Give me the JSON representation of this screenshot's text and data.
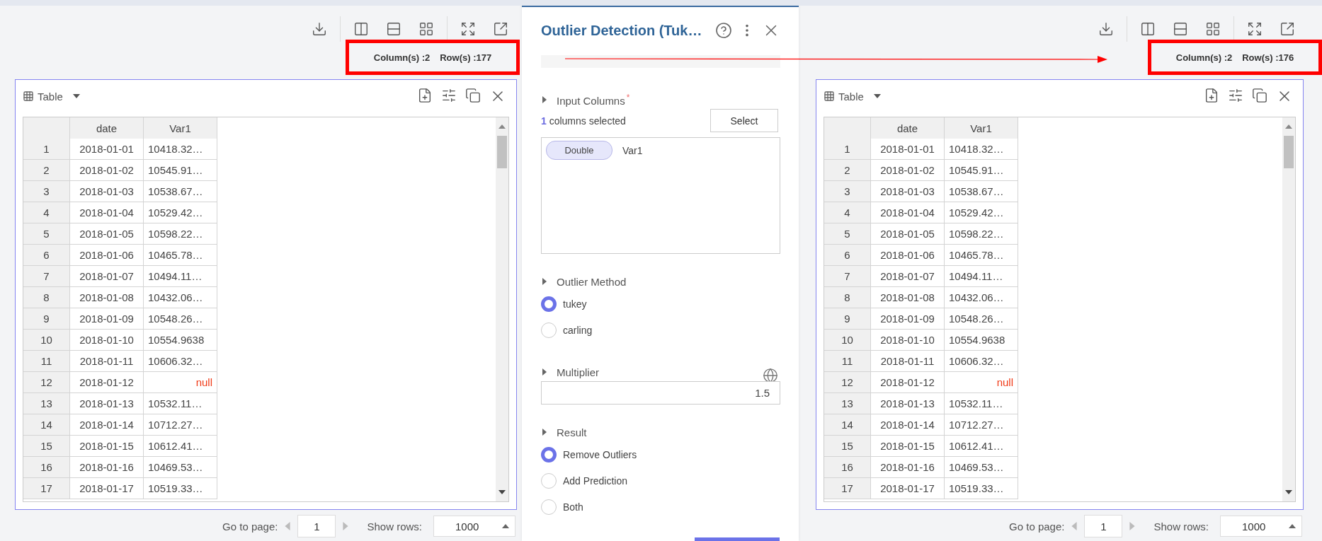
{
  "panes": [
    {
      "counts": {
        "columns": "Column(s) :2",
        "rows": "Row(s) :177",
        "highlighted": true
      },
      "table": {
        "title": "Table",
        "columns": [
          "date",
          "Var1"
        ],
        "rows": [
          {
            "index": "1",
            "date": "2018-01-01",
            "var1": "10418.32…",
            "kind": "number"
          },
          {
            "index": "2",
            "date": "2018-01-02",
            "var1": "10545.91…",
            "kind": "number"
          },
          {
            "index": "3",
            "date": "2018-01-03",
            "var1": "10538.67…",
            "kind": "number"
          },
          {
            "index": "4",
            "date": "2018-01-04",
            "var1": "10529.42…",
            "kind": "number"
          },
          {
            "index": "5",
            "date": "2018-01-05",
            "var1": "10598.22…",
            "kind": "number"
          },
          {
            "index": "6",
            "date": "2018-01-06",
            "var1": "10465.78…",
            "kind": "number"
          },
          {
            "index": "7",
            "date": "2018-01-07",
            "var1": "10494.11…",
            "kind": "number"
          },
          {
            "index": "8",
            "date": "2018-01-08",
            "var1": "10432.06…",
            "kind": "number"
          },
          {
            "index": "9",
            "date": "2018-01-09",
            "var1": "10548.26…",
            "kind": "number"
          },
          {
            "index": "10",
            "date": "2018-01-10",
            "var1": "10554.9638",
            "kind": "number"
          },
          {
            "index": "11",
            "date": "2018-01-11",
            "var1": "10606.32…",
            "kind": "number"
          },
          {
            "index": "12",
            "date": "2018-01-12",
            "var1": "null",
            "kind": "null"
          },
          {
            "index": "13",
            "date": "2018-01-13",
            "var1": "10532.11…",
            "kind": "number"
          },
          {
            "index": "14",
            "date": "2018-01-14",
            "var1": "10712.27…",
            "kind": "number"
          },
          {
            "index": "15",
            "date": "2018-01-15",
            "var1": "10612.41…",
            "kind": "number"
          },
          {
            "index": "16",
            "date": "2018-01-16",
            "var1": "10469.53…",
            "kind": "number"
          },
          {
            "index": "17",
            "date": "2018-01-17",
            "var1": "10519.33…",
            "kind": "number"
          }
        ]
      },
      "pagination": {
        "page_label": "Go to page:",
        "page": "1",
        "rows_label": "Show rows:",
        "rows_value": "1000"
      }
    },
    {
      "counts": {
        "columns": "Column(s) :2",
        "rows": "Row(s) :176",
        "highlighted": true
      },
      "table": {
        "title": "Table",
        "columns": [
          "date",
          "Var1"
        ],
        "rows": [
          {
            "index": "1",
            "date": "2018-01-01",
            "var1": "10418.32…",
            "kind": "number"
          },
          {
            "index": "2",
            "date": "2018-01-02",
            "var1": "10545.91…",
            "kind": "number"
          },
          {
            "index": "3",
            "date": "2018-01-03",
            "var1": "10538.67…",
            "kind": "number"
          },
          {
            "index": "4",
            "date": "2018-01-04",
            "var1": "10529.42…",
            "kind": "number"
          },
          {
            "index": "5",
            "date": "2018-01-05",
            "var1": "10598.22…",
            "kind": "number"
          },
          {
            "index": "6",
            "date": "2018-01-06",
            "var1": "10465.78…",
            "kind": "number"
          },
          {
            "index": "7",
            "date": "2018-01-07",
            "var1": "10494.11…",
            "kind": "number"
          },
          {
            "index": "8",
            "date": "2018-01-08",
            "var1": "10432.06…",
            "kind": "number"
          },
          {
            "index": "9",
            "date": "2018-01-09",
            "var1": "10548.26…",
            "kind": "number"
          },
          {
            "index": "10",
            "date": "2018-01-10",
            "var1": "10554.9638",
            "kind": "number"
          },
          {
            "index": "11",
            "date": "2018-01-11",
            "var1": "10606.32…",
            "kind": "number"
          },
          {
            "index": "12",
            "date": "2018-01-12",
            "var1": "null",
            "kind": "null"
          },
          {
            "index": "13",
            "date": "2018-01-13",
            "var1": "10532.11…",
            "kind": "number"
          },
          {
            "index": "14",
            "date": "2018-01-14",
            "var1": "10712.27…",
            "kind": "number"
          },
          {
            "index": "15",
            "date": "2018-01-15",
            "var1": "10612.41…",
            "kind": "number"
          },
          {
            "index": "16",
            "date": "2018-01-16",
            "var1": "10469.53…",
            "kind": "number"
          },
          {
            "index": "17",
            "date": "2018-01-17",
            "var1": "10519.33…",
            "kind": "number"
          }
        ]
      },
      "pagination": {
        "page_label": "Go to page:",
        "page": "1",
        "rows_label": "Show rows:",
        "rows_value": "1000"
      }
    }
  ],
  "panel": {
    "title": "Outlier Detection (Tuk…",
    "annotation_arrow": true,
    "sections": [
      {
        "kind": "columns",
        "title": "Input Columns",
        "required_mark": "*",
        "count": "1",
        "count_text": "columns selected",
        "button": "Select",
        "items": [
          {
            "type": "Double",
            "name": "Var1"
          }
        ]
      },
      {
        "kind": "radio",
        "title": "Outlier Method",
        "options": [
          {
            "label": "tukey",
            "selected": true
          },
          {
            "label": "carling",
            "selected": false
          }
        ]
      },
      {
        "kind": "number",
        "title": "Multiplier",
        "value": "1.5"
      },
      {
        "kind": "radio",
        "title": "Result",
        "options": [
          {
            "label": "Remove Outliers",
            "selected": true
          },
          {
            "label": "Add Prediction",
            "selected": false
          },
          {
            "label": "Both",
            "selected": false
          }
        ]
      }
    ]
  }
}
